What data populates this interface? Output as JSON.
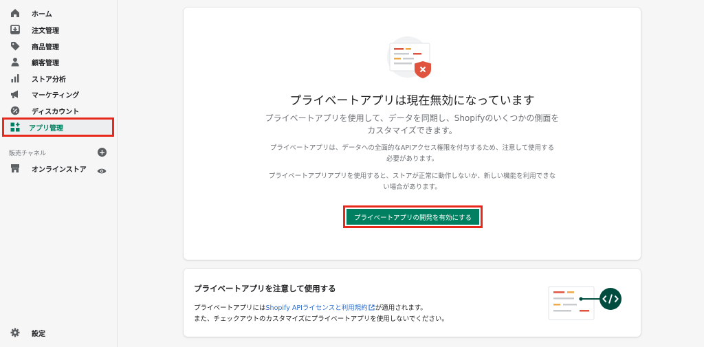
{
  "sidebar": {
    "items": [
      {
        "label": "ホーム",
        "icon": "home-icon"
      },
      {
        "label": "注文管理",
        "icon": "orders-icon"
      },
      {
        "label": "商品管理",
        "icon": "tag-icon"
      },
      {
        "label": "顧客管理",
        "icon": "person-icon"
      },
      {
        "label": "ストア分析",
        "icon": "bar-chart-icon"
      },
      {
        "label": "マーケティング",
        "icon": "megaphone-icon"
      },
      {
        "label": "ディスカウント",
        "icon": "discount-icon"
      },
      {
        "label": "アプリ管理",
        "icon": "apps-icon",
        "active": true
      }
    ],
    "channels_label": "販売チャネル",
    "online_store": "オンラインストア",
    "settings": "設定"
  },
  "main_card": {
    "title": "プライベートアプリは現在無効になっています",
    "subtitle": "プライベートアプリを使用して、データを同期し、Shopifyのいくつかの側面をカスタマイズできます。",
    "note1": "プライベートアプリは、データへの全面的なAPIアクセス権限を付与するため、注意して使用する必要があります。",
    "note2": "プライベートアプリアプリを使用すると、ストアが正常に動作しないか、新しい機能を利用できない場合があります。",
    "enable_button": "プライベートアプリの開発を有効にする"
  },
  "notice_card": {
    "title": "プライベートアプリを注意して使用する",
    "line1_prefix": "プライベートアプリには",
    "line1_link": "Shopify APIライセンスと利用規約",
    "line1_suffix": "が適用されます。",
    "line2": "また、チェックアウトのカスタマイズにプライベートアプリを使用しないでください。"
  },
  "colors": {
    "primary": "#008060",
    "highlight_border": "#e8281b",
    "link": "#2c6ecb",
    "danger": "#e0543f"
  }
}
